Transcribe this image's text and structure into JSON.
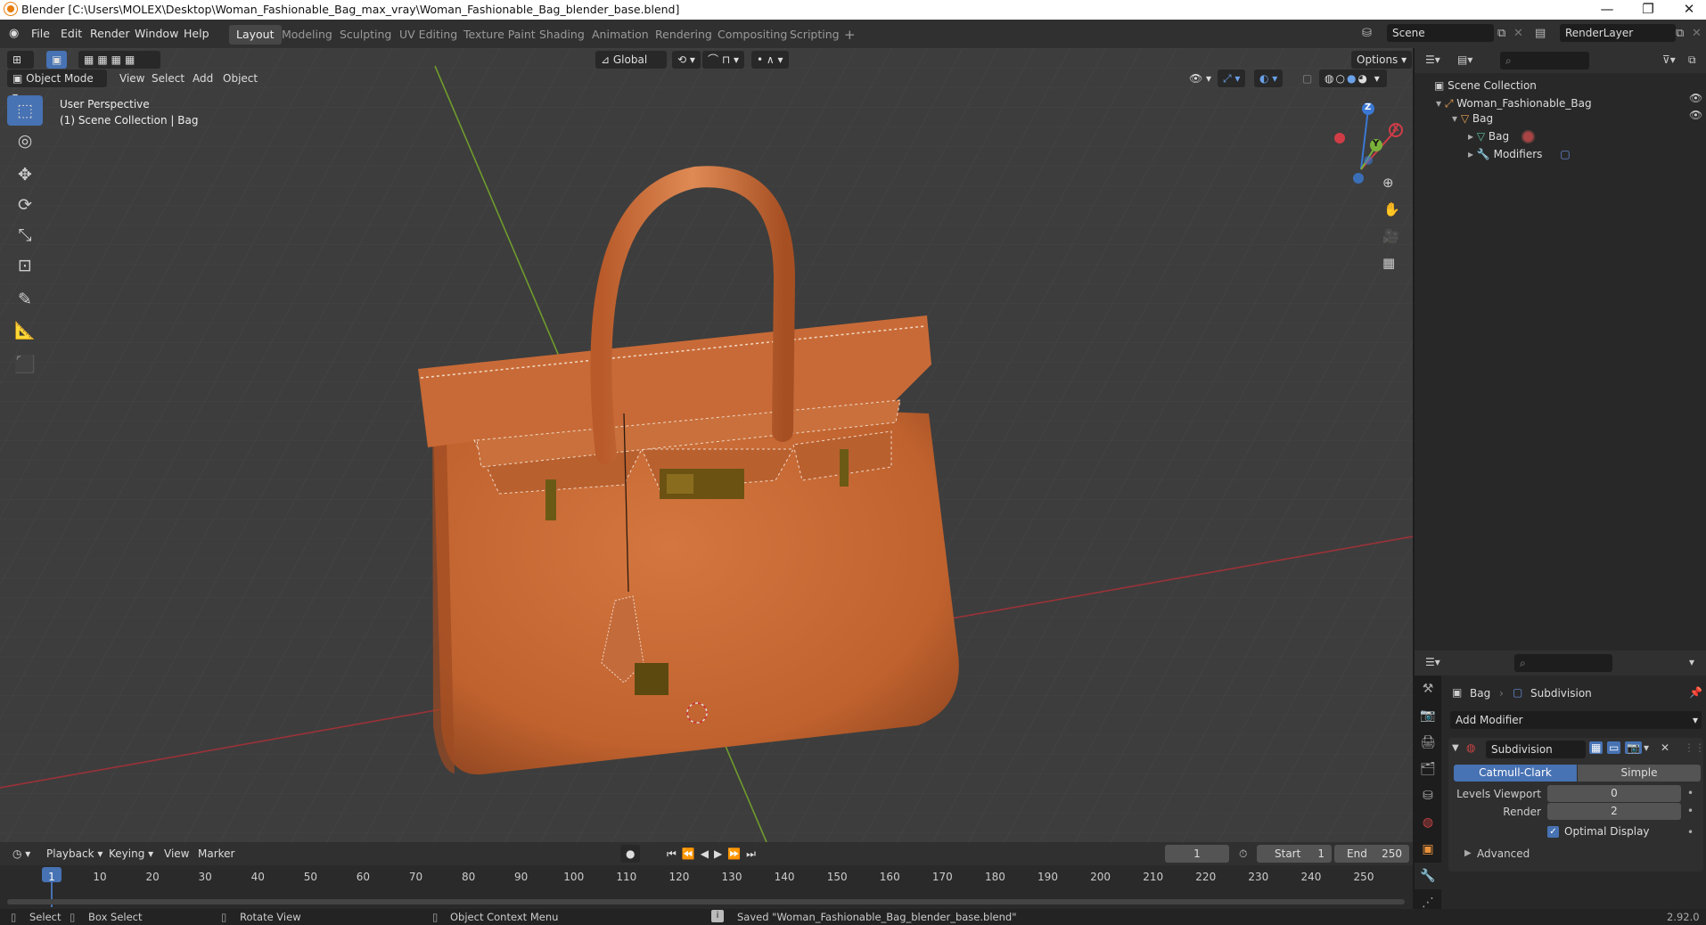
{
  "window": {
    "title": "Blender [C:\\Users\\MOLEX\\Desktop\\Woman_Fashionable_Bag_max_vray\\Woman_Fashionable_Bag_blender_base.blend]",
    "minimize": "—",
    "maximize": "❐",
    "close": "✕"
  },
  "menu": [
    "File",
    "Edit",
    "Render",
    "Window",
    "Help"
  ],
  "workspaces": [
    "Layout",
    "Modeling",
    "Sculpting",
    "UV Editing",
    "Texture Paint",
    "Shading",
    "Animation",
    "Rendering",
    "Compositing",
    "Scripting"
  ],
  "active_workspace": "Layout",
  "add_workspace": "+",
  "scene": {
    "label": "Scene",
    "render_layer": "RenderLayer"
  },
  "viewport": {
    "orientation": "Global",
    "options": "Options",
    "mode": "Object Mode",
    "header_menu": [
      "View",
      "Select",
      "Add",
      "Object"
    ],
    "info_line1": "User Perspective",
    "info_line2": "(1) Scene Collection | Bag",
    "axes": {
      "x": "X",
      "y": "Y",
      "z": "Z"
    }
  },
  "outliner": {
    "root": "Scene Collection",
    "items": [
      {
        "label": "Woman_Fashionable_Bag"
      },
      {
        "label": "Bag"
      },
      {
        "label": "Bag"
      },
      {
        "label": "Modifiers"
      }
    ]
  },
  "properties": {
    "breadcrumb_object": "Bag",
    "breadcrumb_modifier": "Subdivision",
    "add_modifier": "Add Modifier",
    "modifier_name": "Subdivision",
    "type_catmull": "Catmull-Clark",
    "type_simple": "Simple",
    "levels_viewport_label": "Levels Viewport",
    "levels_viewport_value": "0",
    "render_label": "Render",
    "render_value": "2",
    "optimal_display": "Optimal Display",
    "advanced": "Advanced"
  },
  "timeline": {
    "menu": [
      "Playback",
      "Keying",
      "View",
      "Marker"
    ],
    "current_frame": "1",
    "start_label": "Start",
    "start_value": "1",
    "end_label": "End",
    "end_value": "250",
    "ticks": [
      "1",
      "10",
      "20",
      "30",
      "40",
      "50",
      "60",
      "70",
      "80",
      "90",
      "100",
      "110",
      "120",
      "130",
      "140",
      "150",
      "160",
      "170",
      "180",
      "190",
      "200",
      "210",
      "220",
      "230",
      "240",
      "250"
    ]
  },
  "status": {
    "select": "Select",
    "box_select": "Box Select",
    "rotate_view": "Rotate View",
    "context_menu": "Object Context Menu",
    "message": "Saved \"Woman_Fashionable_Bag_blender_base.blend\"",
    "version": "2.92.0"
  },
  "colors": {
    "accent": "#4772b3",
    "bag": "#c96a35",
    "grid_red": "#a0363c",
    "grid_green": "#6e9a2a"
  }
}
